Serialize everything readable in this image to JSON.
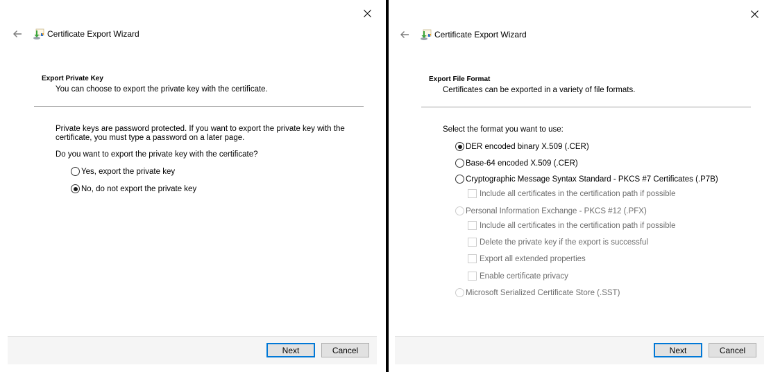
{
  "windows": [
    {
      "title": "Certificate Export Wizard",
      "page": {
        "heading": "Export Private Key",
        "description": "You can choose to export the private key with the certificate."
      },
      "body": {
        "info_line1": "Private keys are password protected. If you want to export the private key with the",
        "info_line2": "certificate, you must type a password on a later page.",
        "question": "Do you want to export the private key with the certificate?",
        "options": [
          {
            "label": "Yes, export the private key",
            "checked": false,
            "enabled": true
          },
          {
            "label": "No, do not export the private key",
            "checked": true,
            "enabled": true
          }
        ]
      },
      "footer": {
        "next_label": "Next",
        "cancel_label": "Cancel"
      }
    },
    {
      "title": "Certificate Export Wizard",
      "page": {
        "heading": "Export File Format",
        "description": "Certificates can be exported in a variety of file formats."
      },
      "body": {
        "prompt": "Select the format you want to use:",
        "formats": [
          {
            "label": "DER encoded binary X.509 (.CER)",
            "checked": true,
            "enabled": true
          },
          {
            "label": "Base-64 encoded X.509 (.CER)",
            "checked": false,
            "enabled": true
          },
          {
            "label": "Cryptographic Message Syntax Standard - PKCS #7 Certificates (.P7B)",
            "checked": false,
            "enabled": true
          },
          {
            "label": "Personal Information Exchange - PKCS #12 (.PFX)",
            "checked": false,
            "enabled": false
          },
          {
            "label": "Microsoft Serialized Certificate Store (.SST)",
            "checked": false,
            "enabled": false
          }
        ],
        "p7b_options": [
          {
            "label": "Include all certificates in the certification path if possible",
            "checked": false,
            "enabled": false
          }
        ],
        "pfx_options": [
          {
            "label": "Include all certificates in the certification path if possible",
            "checked": false,
            "enabled": false
          },
          {
            "label": "Delete the private key if the export is successful",
            "checked": false,
            "enabled": false
          },
          {
            "label": "Export all extended properties",
            "checked": false,
            "enabled": false
          },
          {
            "label": "Enable certificate privacy",
            "checked": false,
            "enabled": false
          }
        ]
      },
      "footer": {
        "next_label": "Next",
        "cancel_label": "Cancel"
      }
    }
  ],
  "icons": {
    "close": "close-icon",
    "back": "back-arrow-icon",
    "wizard": "certificate-wizard-icon"
  },
  "colors": {
    "primary_button_border": "#0078d7",
    "footer_bg": "#f5f5f5",
    "disabled_text": "#6d6d6d"
  }
}
